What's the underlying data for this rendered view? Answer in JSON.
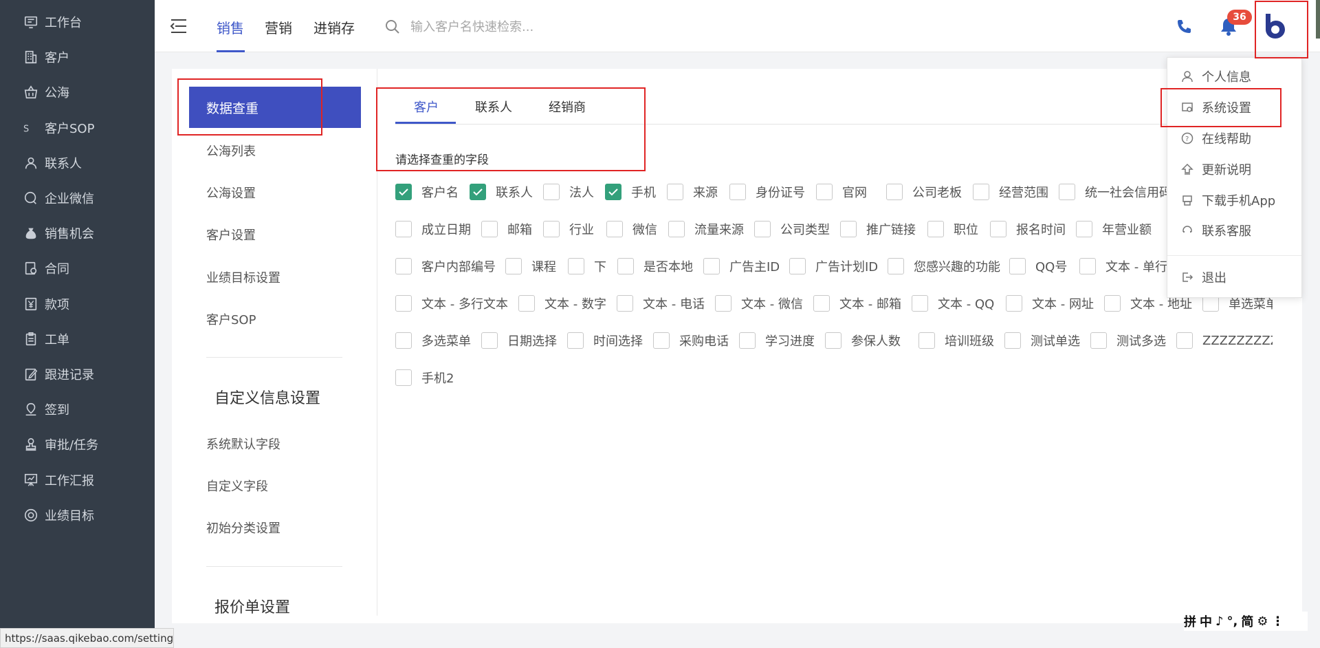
{
  "sidebar": {
    "items": [
      {
        "label": "工作台",
        "icon": "desktop-icon"
      },
      {
        "label": "客户",
        "icon": "building-icon"
      },
      {
        "label": "公海",
        "icon": "basket-icon"
      },
      {
        "label": "客户SOP",
        "icon": "sop-icon"
      },
      {
        "label": "联系人",
        "icon": "person-icon"
      },
      {
        "label": "企业微信",
        "icon": "chat-icon"
      },
      {
        "label": "销售机会",
        "icon": "money-bag-icon"
      },
      {
        "label": "合同",
        "icon": "contract-icon"
      },
      {
        "label": "款项",
        "icon": "yuan-icon"
      },
      {
        "label": "工单",
        "icon": "clipboard-icon"
      },
      {
        "label": "跟进记录",
        "icon": "edit-icon"
      },
      {
        "label": "签到",
        "icon": "location-icon"
      },
      {
        "label": "审批/任务",
        "icon": "stamp-icon"
      },
      {
        "label": "工作汇报",
        "icon": "presentation-icon"
      },
      {
        "label": "业绩目标",
        "icon": "target-icon"
      }
    ]
  },
  "header": {
    "nav": [
      "销售",
      "营销",
      "进销存"
    ],
    "active_nav": "销售",
    "search_placeholder": "输入客户名快速检索...",
    "notification_count": "36",
    "colors": {
      "accent": "#3f58c9",
      "badge": "#e74c3c",
      "sidebar_bg": "#343d48"
    }
  },
  "left_menu": {
    "items": [
      "数据查重",
      "公海列表",
      "公海设置",
      "客户设置",
      "业绩目标设置",
      "客户SOP"
    ],
    "active": "数据查重",
    "custom_section": {
      "title": "自定义信息设置",
      "items": [
        "系统默认字段",
        "自定义字段",
        "初始分类设置"
      ]
    },
    "quote_section": {
      "title": "报价单设置"
    }
  },
  "main": {
    "tabs": [
      "客户",
      "联系人",
      "经销商"
    ],
    "active_tab": "客户",
    "prompt": "请选择查重的字段",
    "fields": [
      [
        {
          "label": "客户名",
          "checked": true
        },
        {
          "label": "联系人",
          "checked": true
        },
        {
          "label": "法人",
          "checked": false
        },
        {
          "label": "手机",
          "checked": true
        },
        {
          "label": "来源",
          "checked": false
        },
        {
          "label": "身份证号",
          "checked": false
        },
        {
          "label": "官网",
          "checked": false
        },
        {
          "label": "公司老板",
          "checked": false
        },
        {
          "label": "经营范围",
          "checked": false
        },
        {
          "label": "统一社会信用码",
          "checked": false
        }
      ],
      [
        {
          "label": "成立日期",
          "checked": false
        },
        {
          "label": "邮箱",
          "checked": false
        },
        {
          "label": "行业",
          "checked": false
        },
        {
          "label": "微信",
          "checked": false
        },
        {
          "label": "流量来源",
          "checked": false
        },
        {
          "label": "公司类型",
          "checked": false
        },
        {
          "label": "推广链接",
          "checked": false
        },
        {
          "label": "职位",
          "checked": false
        },
        {
          "label": "报名时间",
          "checked": false
        },
        {
          "label": "年营业额",
          "checked": false
        }
      ],
      [
        {
          "label": "客户内部编号",
          "checked": false
        },
        {
          "label": "课程",
          "checked": false
        },
        {
          "label": "下",
          "checked": false
        },
        {
          "label": "是否本地",
          "checked": false
        },
        {
          "label": "广告主ID",
          "checked": false
        },
        {
          "label": "广告计划ID",
          "checked": false
        },
        {
          "label": "您感兴趣的功能",
          "checked": false
        },
        {
          "label": "QQ号",
          "checked": false
        },
        {
          "label": "文本 - 单行",
          "checked": false
        }
      ],
      [
        {
          "label": "文本 - 多行文本",
          "checked": false
        },
        {
          "label": "文本 - 数字",
          "checked": false
        },
        {
          "label": "文本 - 电话",
          "checked": false
        },
        {
          "label": "文本 - 微信",
          "checked": false
        },
        {
          "label": "文本 - 邮箱",
          "checked": false
        },
        {
          "label": "文本 - QQ",
          "checked": false
        },
        {
          "label": "文本 - 网址",
          "checked": false
        },
        {
          "label": "文本 - 地址",
          "checked": false
        },
        {
          "label": "单选菜单",
          "checked": false
        }
      ],
      [
        {
          "label": "多选菜单",
          "checked": false
        },
        {
          "label": "日期选择",
          "checked": false
        },
        {
          "label": "时间选择",
          "checked": false
        },
        {
          "label": "采购电话",
          "checked": false
        },
        {
          "label": "学习进度",
          "checked": false
        },
        {
          "label": "参保人数",
          "checked": false
        },
        {
          "label": "培训班级",
          "checked": false
        },
        {
          "label": "测试单选",
          "checked": false
        },
        {
          "label": "测试多选",
          "checked": false
        },
        {
          "label": "ZZZZZZZZZ",
          "checked": false
        }
      ],
      [
        {
          "label": "手机2",
          "checked": false
        }
      ]
    ]
  },
  "dropdown": {
    "items": [
      {
        "label": "个人信息",
        "icon": "user-icon"
      },
      {
        "label": "系统设置",
        "icon": "settings-icon"
      },
      {
        "label": "在线帮助",
        "icon": "help-icon"
      },
      {
        "label": "更新说明",
        "icon": "upgrade-icon"
      },
      {
        "label": "下载手机App",
        "icon": "phone-app-icon"
      },
      {
        "label": "联系客服",
        "icon": "headset-icon"
      }
    ],
    "logout": {
      "label": "退出",
      "icon": "logout-icon"
    }
  },
  "status_url": "https://saas.qikebao.com/setting",
  "ime": [
    "拼",
    "中",
    "♪",
    "°,",
    "简",
    "⚙",
    "⋮"
  ]
}
